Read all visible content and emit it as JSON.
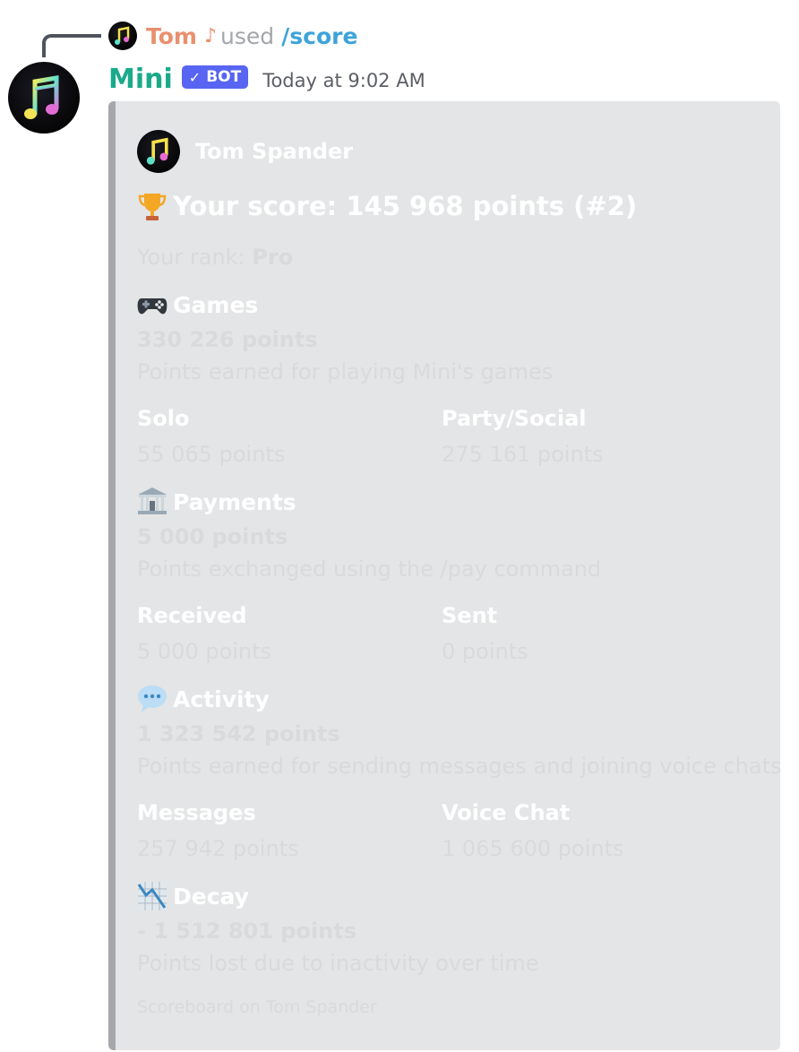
{
  "reply": {
    "user": "Tom",
    "note": "♪",
    "used": "used",
    "command": "/score"
  },
  "author": {
    "name": "Mini",
    "bot_tag": "BOT",
    "bot_check": "✓",
    "timestamp": "Today at 9:02 AM"
  },
  "embed": {
    "author_name": "Tom Spander",
    "title": "Your score: 145 968 points (#2)",
    "rank_label": "Your rank:",
    "rank_value": "Pro",
    "sections": {
      "games": {
        "title": "Games",
        "points": "330 226 points",
        "description": "Points earned for playing Mini's games",
        "fields": [
          {
            "name": "Solo",
            "value": "55 065 points"
          },
          {
            "name": "Party/Social",
            "value": "275 161 points"
          }
        ]
      },
      "payments": {
        "title": "Payments",
        "points": "5 000 points",
        "description": "Points exchanged using the /pay command",
        "fields": [
          {
            "name": "Received",
            "value": "5 000 points"
          },
          {
            "name": "Sent",
            "value": "0 points"
          }
        ]
      },
      "activity": {
        "title": "Activity",
        "points": "1 323 542 points",
        "description": "Points earned for sending messages and joining voice chats",
        "fields": [
          {
            "name": "Messages",
            "value": "257 942 points"
          },
          {
            "name": "Voice Chat",
            "value": "1 065 600 points"
          }
        ]
      },
      "decay": {
        "title": "Decay",
        "points": "- 1 512 801 points",
        "description": "Points lost due to inactivity over time"
      }
    },
    "footer": "Scoreboard on Tom Spander"
  },
  "icons": {
    "trophy": "trophy-icon",
    "games": "game-controller-icon",
    "payments": "bank-icon",
    "activity": "speech-bubble-icon",
    "decay": "chart-decreasing-icon"
  },
  "colors": {
    "bot_name": "#1aaa8a",
    "reply_user": "#e8906e",
    "command": "#3da4d9",
    "bot_tag": "#5865f2",
    "embed_bg": "#e3e5e6",
    "embed_border": "#a5a7aa"
  }
}
